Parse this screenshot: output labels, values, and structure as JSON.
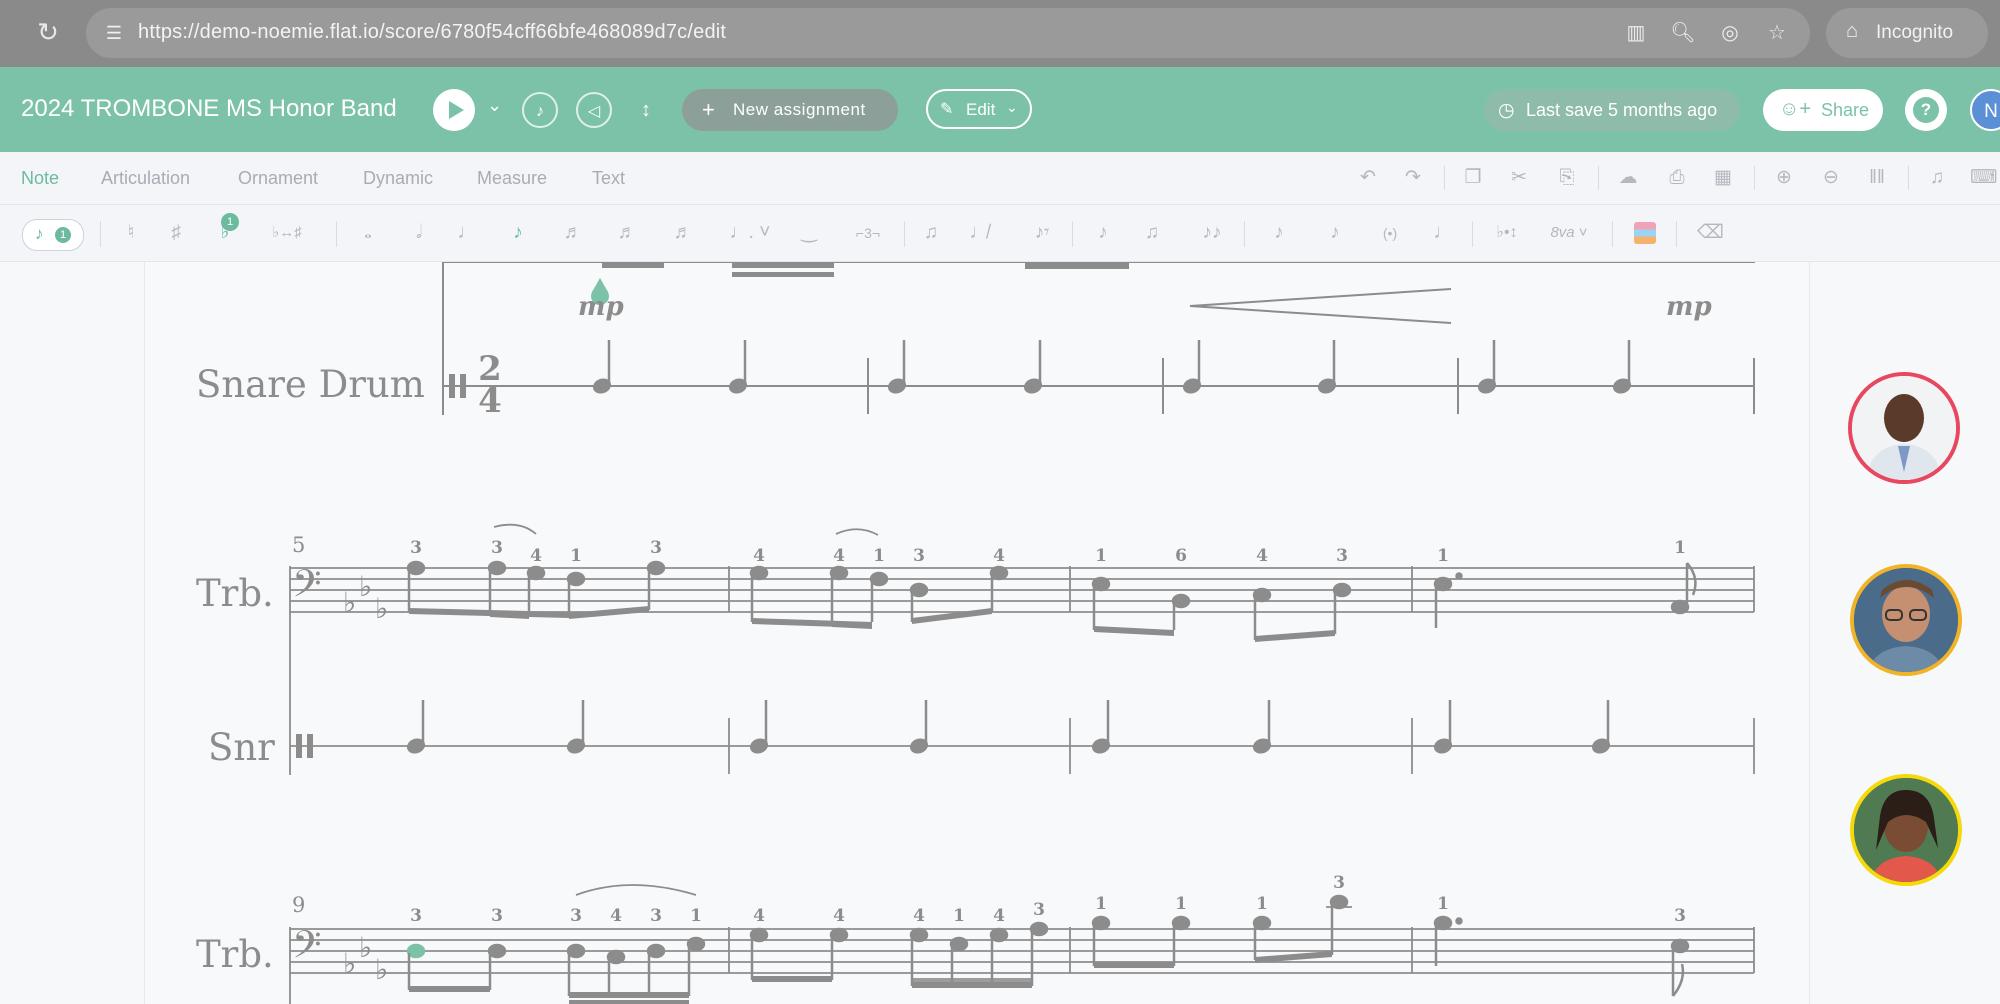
{
  "browser": {
    "url": "https://demo-noemie.flat.io/score/6780f54cff66bfe468089d7c/edit",
    "incognito_label": "Incognito",
    "icons": [
      "reload-icon",
      "site-settings-icon",
      "reading-mode-icon",
      "zoom-icon",
      "eye-off-icon",
      "bookmark-star-icon",
      "incognito-icon"
    ]
  },
  "header": {
    "title": "2024 TROMBONE MS Honor Band",
    "new_assignment_label": "New assignment",
    "edit_label": "Edit",
    "last_save_label": "Last save 5 months ago",
    "share_label": "Share",
    "user_initial": "N",
    "colors": {
      "brand": "#7cc2a8",
      "accent": "#6dbb9f"
    }
  },
  "tabs": [
    {
      "label": "Note",
      "active": true
    },
    {
      "label": "Articulation",
      "active": false
    },
    {
      "label": "Ornament",
      "active": false
    },
    {
      "label": "Dynamic",
      "active": false
    },
    {
      "label": "Measure",
      "active": false
    },
    {
      "label": "Text",
      "active": false
    }
  ],
  "toolbar": {
    "voice_number": "1",
    "voice_badge": "1",
    "grace_badge": "1",
    "ottava_label": "8va",
    "tuplet_label": "3"
  },
  "score": {
    "system1": {
      "instrument": "Snare Drum",
      "time_signature_top": "2",
      "time_signature_bottom": "4",
      "dynamics": [
        "mp",
        "mp"
      ]
    },
    "system2": {
      "measure_number": "5",
      "instruments": [
        "Trb.",
        "Snr"
      ],
      "fingerings": [
        "3",
        "3",
        "4",
        "1",
        "3",
        "4",
        "4",
        "1",
        "3",
        "4",
        "1",
        "6",
        "4",
        "3",
        "1",
        "1"
      ]
    },
    "system3": {
      "measure_number": "9",
      "instrument": "Trb.",
      "fingerings": [
        "3",
        "3",
        "3",
        "4",
        "3",
        "1",
        "4",
        "4",
        "4",
        "1",
        "4",
        "3",
        "1",
        "1",
        "1",
        "3",
        "1",
        "3"
      ]
    }
  },
  "collaborators": [
    {
      "name": "collaborator-1",
      "ring_color": "#e8485f"
    },
    {
      "name": "collaborator-2",
      "ring_color": "#f0b429"
    },
    {
      "name": "collaborator-3",
      "ring_color": "#f5d90a"
    }
  ]
}
